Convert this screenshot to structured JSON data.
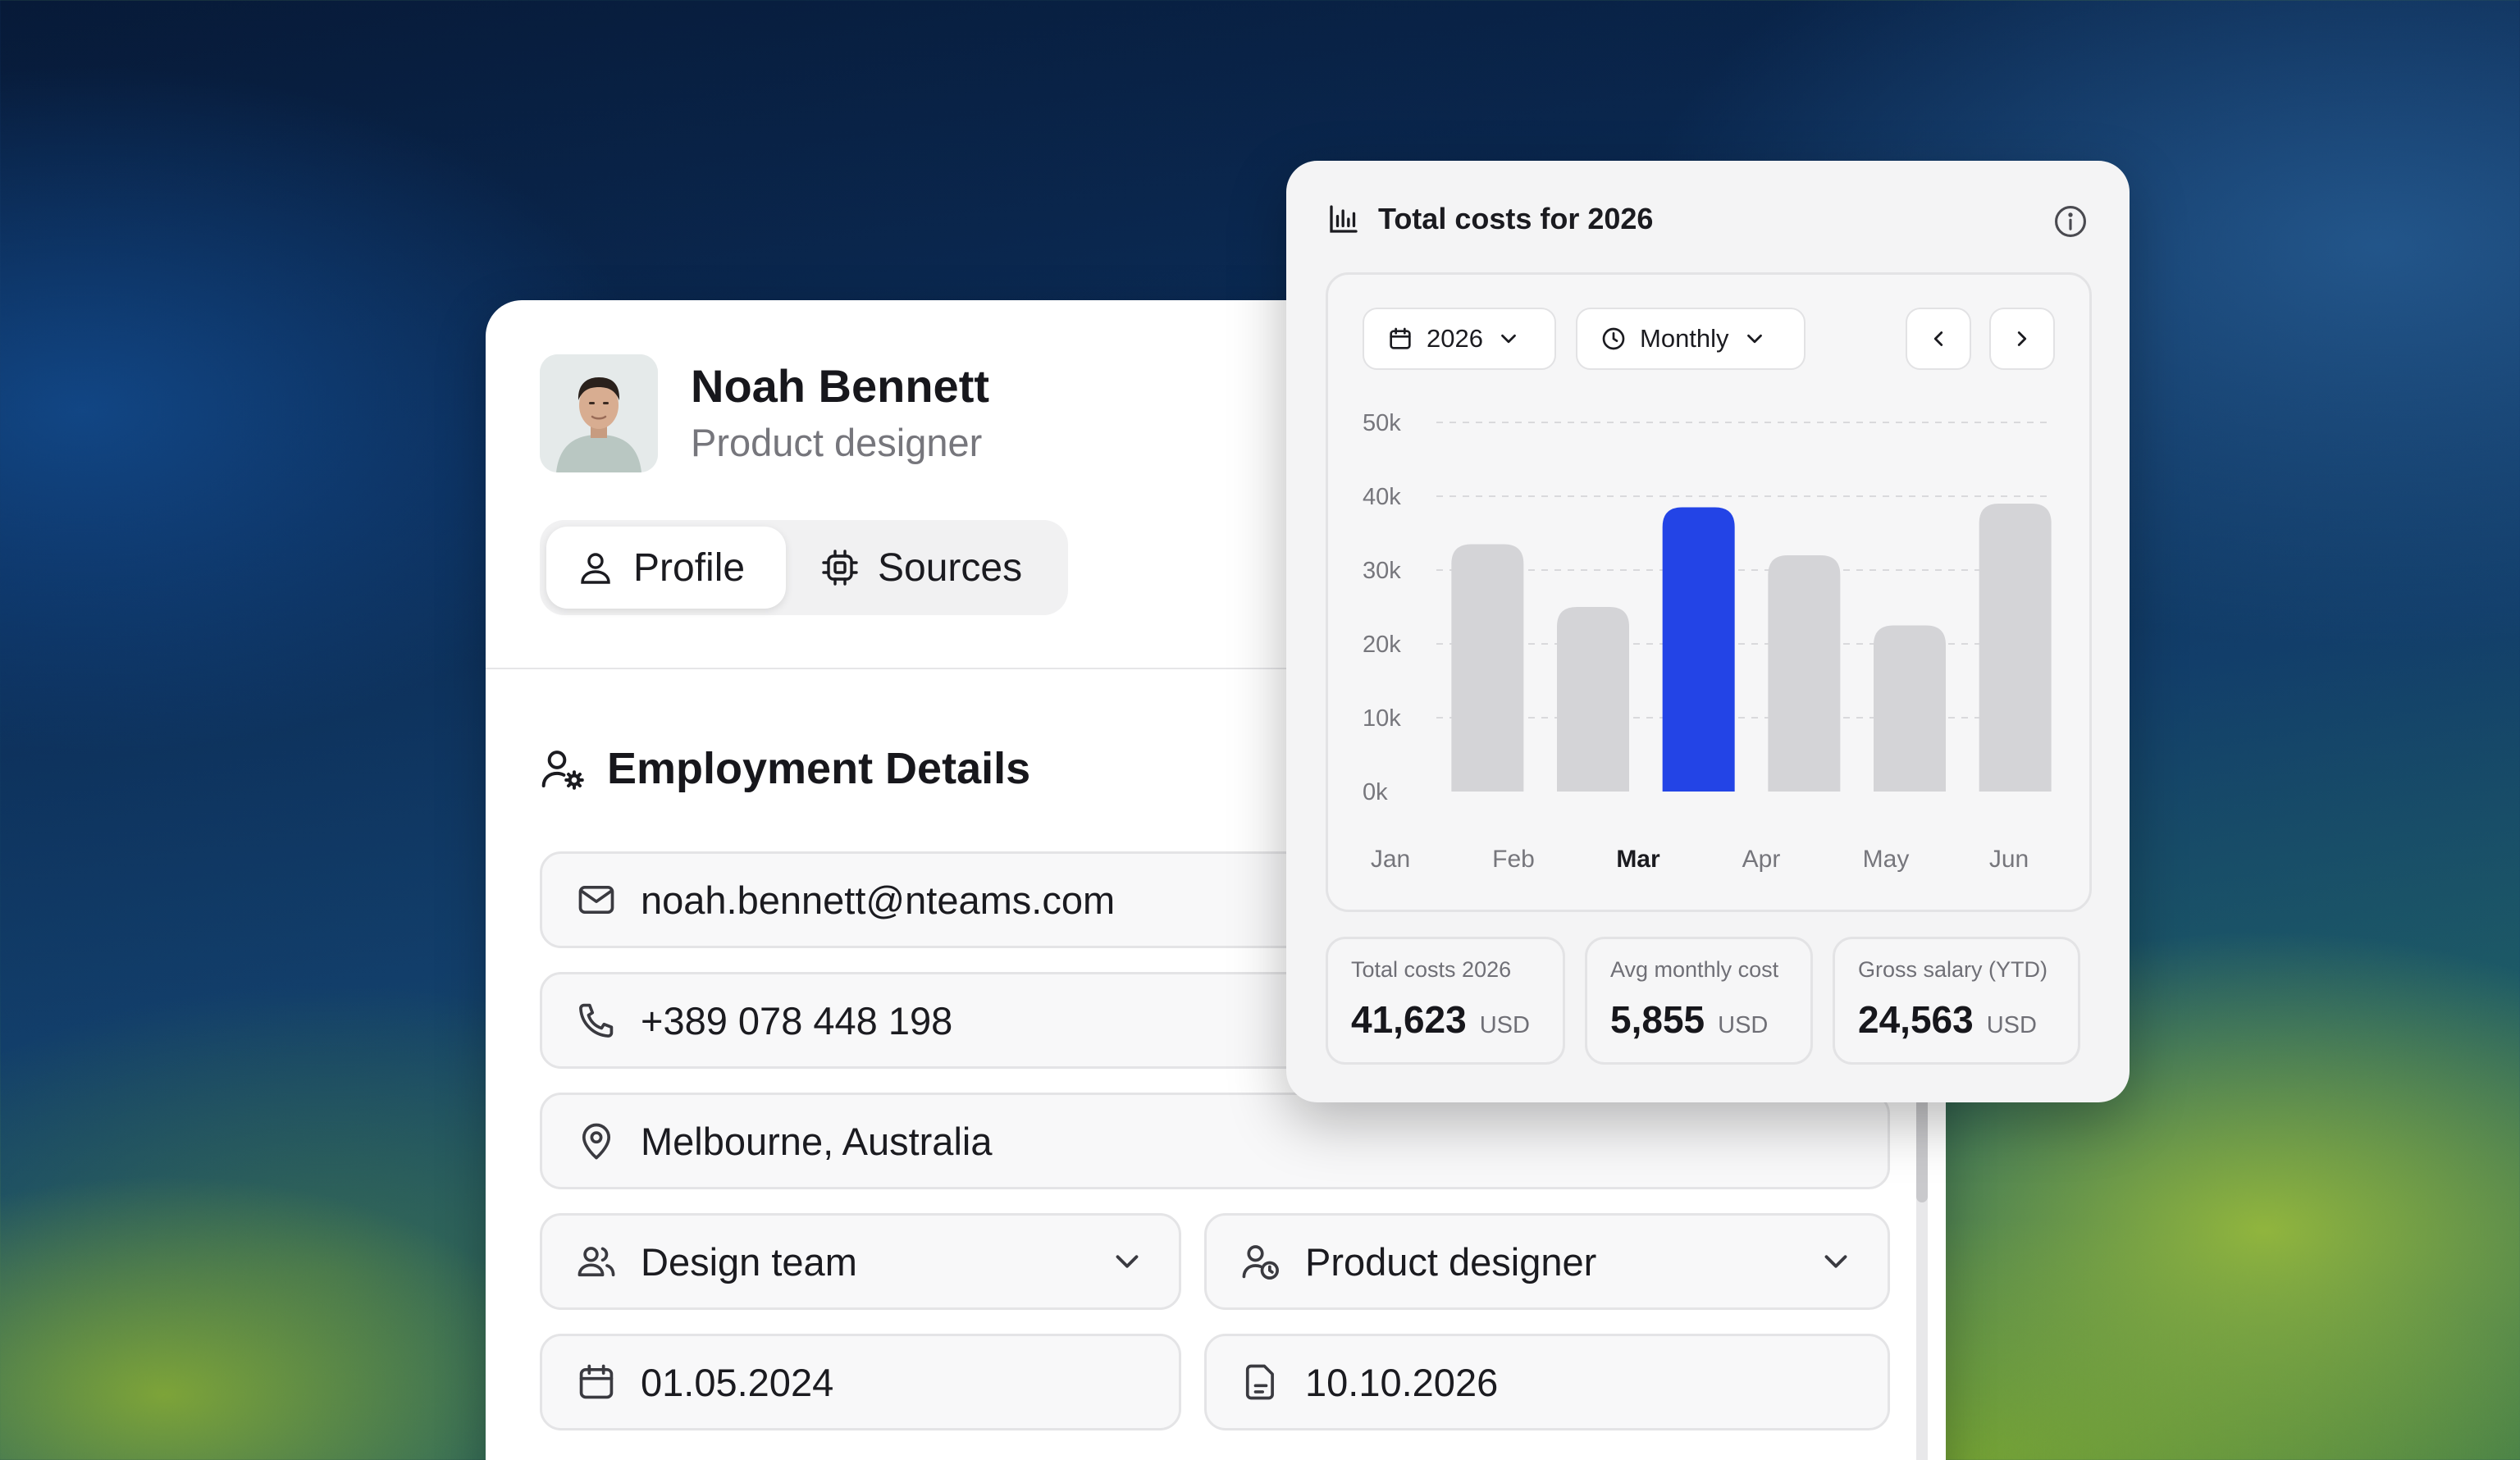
{
  "profile": {
    "name": "Noah Bennett",
    "role": "Product designer",
    "tabs": [
      {
        "label": "Profile",
        "active": true,
        "icon": "user-icon"
      },
      {
        "label": "Sources",
        "active": false,
        "icon": "cpu-icon"
      }
    ]
  },
  "employment": {
    "title": "Employment Details",
    "email": "noah.bennett@nteams.com",
    "phone": "+389 078 448 198",
    "location": "Melbourne, Australia",
    "team": "Design team",
    "position": "Product designer",
    "start_date": "01.05.2024",
    "end_date": "10.10.2026"
  },
  "costs": {
    "title": "Total costs for 2026",
    "year_select": "2026",
    "period_select": "Monthly",
    "accent_color": "#2344e6",
    "bar_color": "#d4d4d7",
    "stats": [
      {
        "label": "Total costs 2026",
        "value": "41,623",
        "unit": "USD"
      },
      {
        "label": "Avg monthly cost",
        "value": "5,855",
        "unit": "USD"
      },
      {
        "label": "Gross salary (YTD)",
        "value": "24,563",
        "unit": "USD"
      }
    ]
  },
  "chart_data": {
    "type": "bar",
    "categories": [
      "Jan",
      "Feb",
      "Mar",
      "Apr",
      "May",
      "Jun"
    ],
    "values": [
      33500,
      25000,
      38500,
      32000,
      22500,
      39000
    ],
    "highlight_index": 2,
    "yticks": [
      "0k",
      "10k",
      "20k",
      "30k",
      "40k",
      "50k"
    ],
    "ylim": [
      0,
      50000
    ],
    "grid": true
  }
}
